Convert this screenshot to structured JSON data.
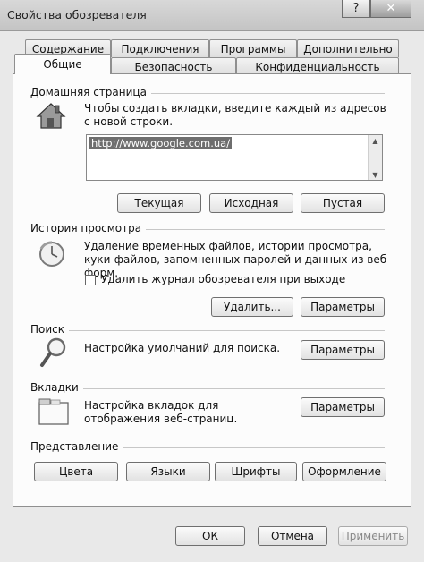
{
  "window": {
    "title": "Свойства обозревателя",
    "help_glyph": "?",
    "close_glyph": "✕"
  },
  "tabs_back": [
    "Содержание",
    "Подключения",
    "Программы",
    "Дополнительно"
  ],
  "tabs_front": [
    "Общие",
    "Безопасность",
    "Конфиденциальность"
  ],
  "home": {
    "label": "Домашняя страница",
    "description": "Чтобы создать вкладки, введите каждый из адресов с новой строки.",
    "url": "http://www.google.com.ua/",
    "buttons": [
      "Текущая",
      "Исходная",
      "Пустая"
    ]
  },
  "history": {
    "label": "История просмотра",
    "description": "Удаление временных файлов, истории просмотра, куки-файлов, запомненных паролей и данных из веб-форм.",
    "checkbox_label": "Удалить журнал обозревателя при выходе",
    "checkbox_checked": false,
    "delete_button": "Удалить...",
    "settings_button": "Параметры"
  },
  "search": {
    "label": "Поиск",
    "description": "Настройка умолчаний для поиска.",
    "settings_button": "Параметры"
  },
  "tabs_section": {
    "label": "Вкладки",
    "description": "Настройка вкладок для отображения веб-страниц.",
    "settings_button": "Параметры"
  },
  "appearance": {
    "label": "Представление",
    "buttons": [
      "Цвета",
      "Языки",
      "Шрифты",
      "Оформление"
    ]
  },
  "footer": {
    "ok": "ОК",
    "cancel": "Отмена",
    "apply": "Применить"
  }
}
